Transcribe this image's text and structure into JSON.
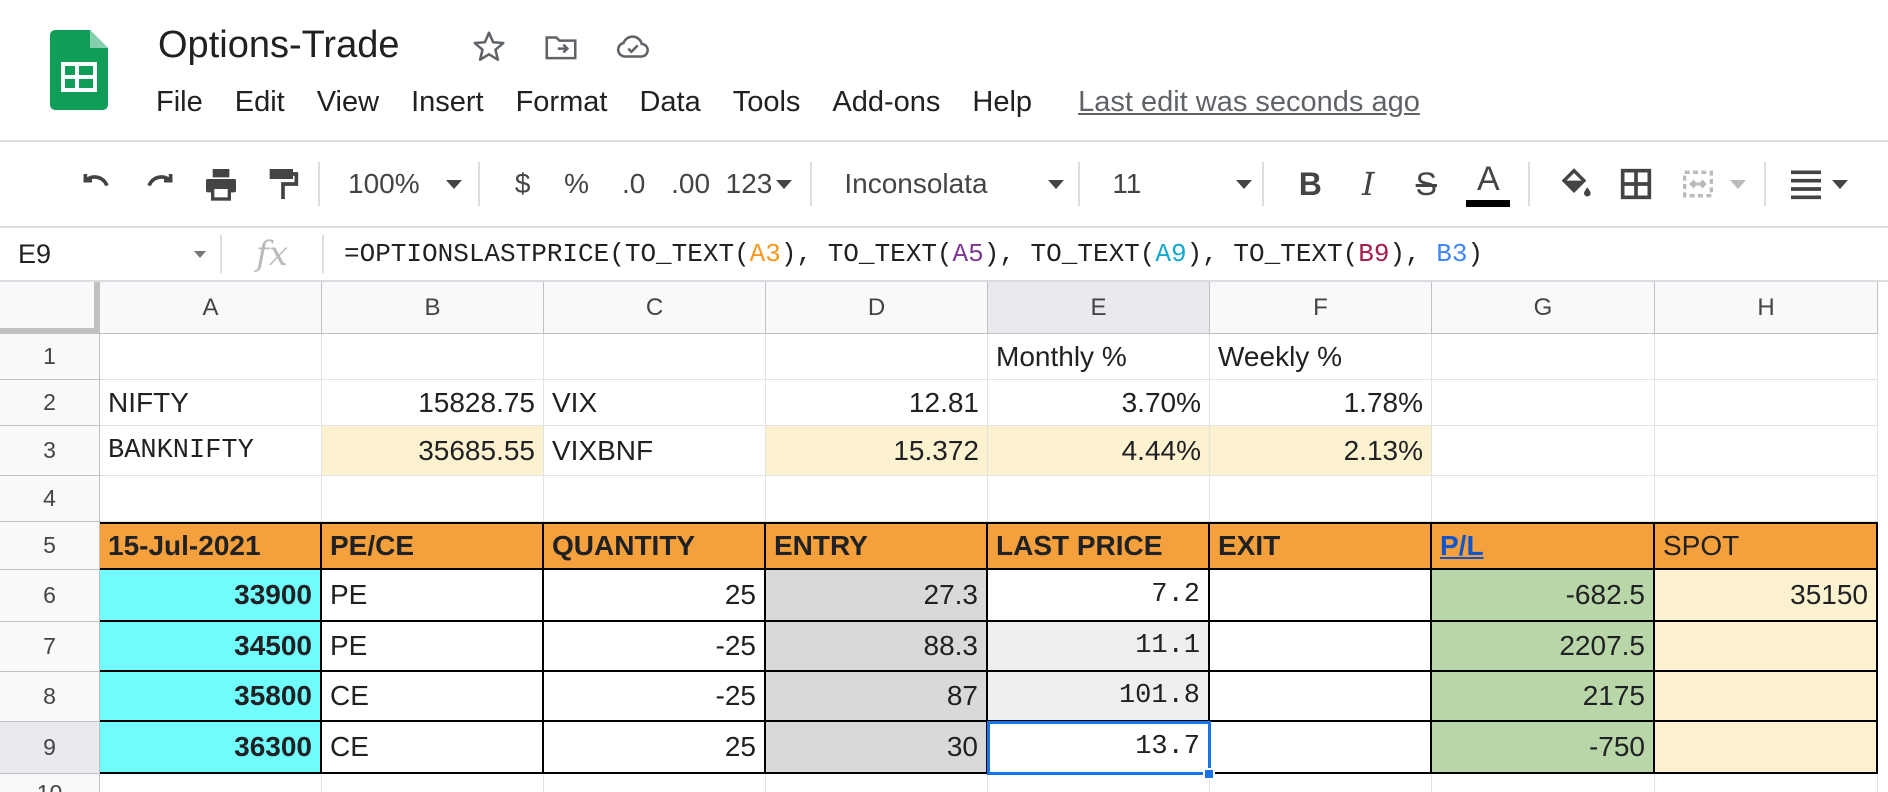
{
  "doc": {
    "title": "Options-Trade"
  },
  "menu": [
    "File",
    "Edit",
    "View",
    "Insert",
    "Format",
    "Data",
    "Tools",
    "Add-ons",
    "Help"
  ],
  "last_edit": "Last edit was seconds ago",
  "toolbar": {
    "zoom": "100%",
    "currency": "$",
    "percent": "%",
    "dec_decrease": ".0",
    "dec_increase": ".00",
    "more_formats": "123",
    "font": "Inconsolata",
    "font_size": "11",
    "bold": "B",
    "italic": "I",
    "strike": "S",
    "text_color": "A"
  },
  "formula_bar": {
    "cell_ref": "E9",
    "fx": "fx",
    "formula_parts": [
      "=OPTIONSLASTPRICE(TO_TEXT(",
      "A3",
      "), TO_TEXT(",
      "A5",
      "), TO_TEXT(",
      "A9",
      "), TO_TEXT(",
      "B9",
      "), ",
      "B3",
      ")"
    ]
  },
  "columns": [
    "A",
    "B",
    "C",
    "D",
    "E",
    "F",
    "G",
    "H"
  ],
  "rows": [
    "1",
    "2",
    "3",
    "4",
    "5",
    "6",
    "7",
    "8",
    "9",
    "10"
  ],
  "cells": {
    "E1": "Monthly %",
    "F1": "Weekly %",
    "A2": "NIFTY",
    "B2": "15828.75",
    "C2": "VIX",
    "D2": "12.81",
    "E2": "3.70%",
    "F2": "1.78%",
    "A3": "BANKNIFTY",
    "B3": "35685.55",
    "C3": "VIXBNF",
    "D3": "15.372",
    "E3": "4.44%",
    "F3": "2.13%",
    "A5": "15-Jul-2021",
    "B5": "PE/CE",
    "C5": "QUANTITY",
    "D5": "ENTRY",
    "E5": "LAST PRICE",
    "F5": "EXIT",
    "G5": "P/L",
    "H5": "SPOT",
    "A6": "33900",
    "B6": "PE",
    "C6": "25",
    "D6": "27.3",
    "E6": "7.2",
    "G6": "-682.5",
    "H6": "35150",
    "A7": "34500",
    "B7": "PE",
    "C7": "-25",
    "D7": "88.3",
    "E7": "11.1",
    "G7": "2207.5",
    "A8": "35800",
    "B8": "CE",
    "C8": "-25",
    "D8": "87",
    "E8": "101.8",
    "G8": "2175",
    "A9": "36300",
    "B9": "CE",
    "C9": "25",
    "D9": "30",
    "E9": "13.7",
    "G9": "-750"
  },
  "colors": {
    "accent": "#1a73e8",
    "orange": "#f4a03c",
    "cyan": "#72fdfd",
    "green": "#b9d6a8",
    "cream": "#fdf2d0",
    "gray": "#d9d9d9"
  }
}
